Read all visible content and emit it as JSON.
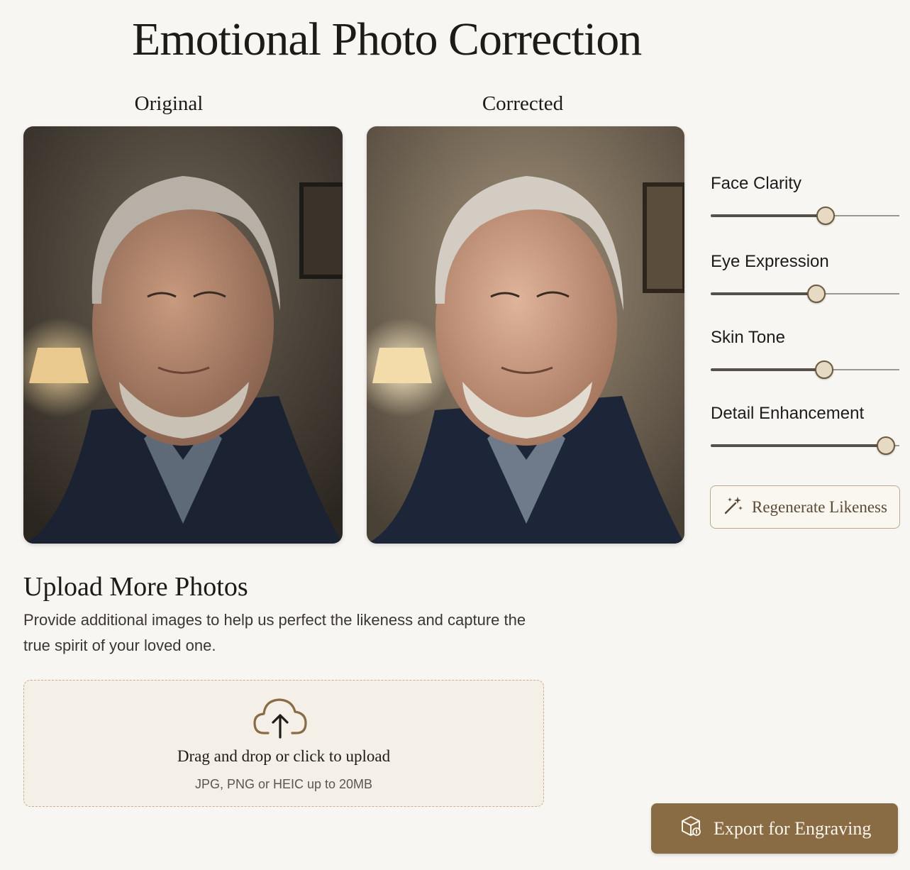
{
  "page": {
    "title": "Emotional Photo Correction"
  },
  "compare": {
    "original_label": "Original",
    "corrected_label": "Corrected"
  },
  "adjustments": {
    "sliders": [
      {
        "label": "Face Clarity",
        "value": 0.61
      },
      {
        "label": "Eye Expression",
        "value": 0.56
      },
      {
        "label": "Skin Tone",
        "value": 0.6
      },
      {
        "label": "Detail Enhancement",
        "value": 0.93
      }
    ],
    "regenerate_label": "Regenerate Likeness"
  },
  "upload": {
    "title": "Upload More Photos",
    "description": "Provide additional images to help us perfect the likeness and capture the true spirit of your loved one.",
    "dropzone_primary": "Drag and drop or click to upload",
    "dropzone_secondary": "JPG, PNG or HEIC up to 20MB"
  },
  "export": {
    "label": "Export for Engraving"
  },
  "colors": {
    "accent": "#8a6c44",
    "background": "#f8f6f2",
    "dropzone_border": "#cfae8e"
  }
}
